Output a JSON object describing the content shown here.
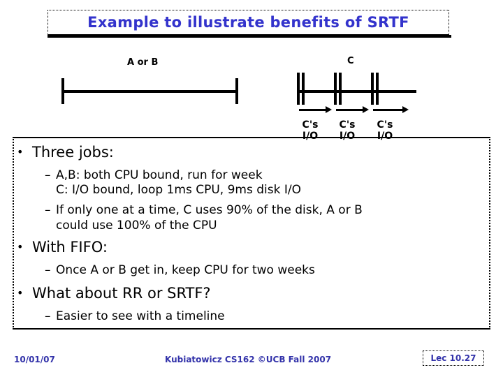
{
  "slide": {
    "title": "Example to illustrate benefits of SRTF"
  },
  "diagram": {
    "timeline_ab": {
      "label": "A or B"
    },
    "timeline_c": {
      "label": "C",
      "segments": [
        {
          "line1": "C's",
          "line2": "I/O"
        },
        {
          "line1": "C's",
          "line2": "I/O"
        },
        {
          "line1": "C's",
          "line2": "I/O"
        }
      ]
    }
  },
  "body": {
    "bullet_dot": "•",
    "sub_dash": "–",
    "items": [
      {
        "level": 1,
        "text": "Three jobs:"
      },
      {
        "level": 2,
        "text": "A,B: both CPU bound, run for week"
      },
      {
        "level": 2,
        "text": "C: I/O bound, loop 1ms CPU, 9ms disk I/O",
        "continuation": true
      },
      {
        "level": 2,
        "text": "If only one at a time, C uses 90% of the disk, A or B could use 100% of the CPU"
      },
      {
        "level": 1,
        "text": "With FIFO:"
      },
      {
        "level": 2,
        "text": "Once A or B get in, keep CPU for two weeks"
      },
      {
        "level": 1,
        "text": "What about RR or SRTF?"
      },
      {
        "level": 2,
        "text": "Easier to see with a timeline"
      }
    ],
    "line_a1": "A,B: both CPU bound, run for week",
    "line_a2": "C: I/O bound, loop 1ms CPU, 9ms disk I/O",
    "line_b1": "If only one at a time, C uses 90% of the disk, A or B",
    "line_b2": "could use 100% of the CPU"
  },
  "footer": {
    "date": "10/01/07",
    "center": "Kubiatowicz CS162 ©UCB Fall 2007",
    "lec": "Lec 10.27"
  },
  "colors": {
    "title_blue": "#3333cc",
    "footer_blue": "#3333aa",
    "ink": "#000000"
  }
}
